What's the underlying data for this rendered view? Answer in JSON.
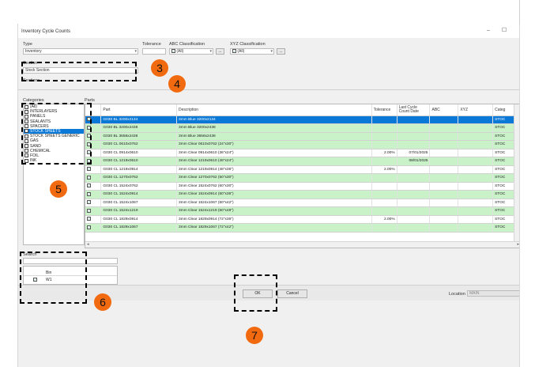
{
  "window": {
    "title": "Inventory Cycle Counts",
    "minimize": "–",
    "maximize": "☐"
  },
  "filters": {
    "type_label": "Type",
    "type_value": "Inventory",
    "tolerance_label": "Tolerance",
    "tolerance_value": "",
    "abc_label": "ABC Classification",
    "abc_value": "(All)",
    "xyz_label": "XYZ Classification",
    "xyz_value": "(All)",
    "ellipsis": "...",
    "section_label": "Section",
    "section_value": "Stock Section",
    "sections_label": "Sections"
  },
  "categories": {
    "label": "Categories",
    "items": [
      {
        "label": "(All)",
        "selected": false
      },
      {
        "label": "INTERLAYERS",
        "selected": false
      },
      {
        "label": "PANELS",
        "selected": false
      },
      {
        "label": "SEALANTS",
        "selected": false
      },
      {
        "label": "SPACERS",
        "selected": false
      },
      {
        "label": "STOCK SHEETS",
        "selected": true
      },
      {
        "label": "STOCK SHEETS GENERIC",
        "selected": false
      },
      {
        "label": "GAS",
        "selected": false
      },
      {
        "label": "SAND",
        "selected": false
      },
      {
        "label": "CHEMICAL",
        "selected": false
      },
      {
        "label": "FOIL",
        "selected": false
      },
      {
        "label": "INK",
        "selected": false
      }
    ]
  },
  "parts": {
    "label": "Parts",
    "columns": [
      "Part",
      "Description",
      "Tolerance",
      "Last Cycle Count Date",
      "ABC",
      "XYZ",
      "Categ"
    ],
    "rows": [
      {
        "part": "G030 BL 3200x2134",
        "desc": "3mm Blue 3200x2134",
        "tol": "",
        "date": "",
        "abc": "",
        "xyz": "",
        "cat": "STOC",
        "checked": true,
        "style": "selrow"
      },
      {
        "part": "G030 BL 3200x2438",
        "desc": "3mm Blue 3200x2438",
        "tol": "",
        "date": "",
        "abc": "",
        "xyz": "",
        "cat": "STOC",
        "checked": true,
        "style": "green"
      },
      {
        "part": "G030 BL 3658x2438",
        "desc": "3mm Blue 3658x2438",
        "tol": "",
        "date": "",
        "abc": "",
        "xyz": "",
        "cat": "STOC",
        "checked": true,
        "style": "green"
      },
      {
        "part": "G030 CL 0610x0762",
        "desc": "3mm Clear 0610x0762 (24\"x30\")",
        "tol": "",
        "date": "",
        "abc": "",
        "xyz": "",
        "cat": "STOC",
        "checked": true,
        "style": "green"
      },
      {
        "part": "G030 CL 0914x0610",
        "desc": "3mm Clear 0914x0610 (36\"x24\")",
        "tol": "2.00%",
        "date": "07/01/2025",
        "abc": "",
        "xyz": "",
        "cat": "STOC",
        "checked": true,
        "style": "white"
      },
      {
        "part": "G030 CL 1219x0610",
        "desc": "3mm Clear 1219x0610 (48\"x24\")",
        "tol": "",
        "date": "08/01/2025",
        "abc": "",
        "xyz": "",
        "cat": "STOC",
        "checked": true,
        "style": "green"
      },
      {
        "part": "G030 CL 1219x0914",
        "desc": "3mm Clear 1219x0914 (48\"x36\")",
        "tol": "2.00%",
        "date": "",
        "abc": "",
        "xyz": "",
        "cat": "STOC",
        "checked": true,
        "style": "white"
      },
      {
        "part": "G030 CL 1270x0762",
        "desc": "3mm Clear 1270x0762 (50\"x30\")",
        "tol": "",
        "date": "",
        "abc": "",
        "xyz": "",
        "cat": "STOC",
        "checked": true,
        "style": "green"
      },
      {
        "part": "G030 CL 1524x0762",
        "desc": "3mm Clear 1524x0762 (60\"x30\")",
        "tol": "",
        "date": "",
        "abc": "",
        "xyz": "",
        "cat": "STOC",
        "checked": true,
        "style": "white"
      },
      {
        "part": "G030 CL 1524x0914",
        "desc": "3mm Clear 1524x0914 (60\"x36\")",
        "tol": "",
        "date": "",
        "abc": "",
        "xyz": "",
        "cat": "STOC",
        "checked": true,
        "style": "green"
      },
      {
        "part": "G030 CL 1524x1067",
        "desc": "3mm Clear 1524x1067 (60\"x42\")",
        "tol": "",
        "date": "",
        "abc": "",
        "xyz": "",
        "cat": "STOC",
        "checked": true,
        "style": "white"
      },
      {
        "part": "G030 CL 1524x1219",
        "desc": "3mm Clear 1524x1219 (60\"x48\")",
        "tol": "",
        "date": "",
        "abc": "",
        "xyz": "",
        "cat": "STOC",
        "checked": true,
        "style": "green"
      },
      {
        "part": "G030 CL 1829x0914",
        "desc": "3mm Clear 1829x0914 (72\"x36\")",
        "tol": "2.00%",
        "date": "",
        "abc": "",
        "xyz": "",
        "cat": "STOC",
        "checked": true,
        "style": "white"
      },
      {
        "part": "G030 CL 1829x1067",
        "desc": "3mm Clear 1829x1067 (72\"x42\")",
        "tol": "",
        "date": "",
        "abc": "",
        "xyz": "",
        "cat": "STOC",
        "checked": true,
        "style": "green"
      }
    ]
  },
  "bins": {
    "search_label": "Search",
    "search_value": "",
    "header": "Bin",
    "rows": [
      {
        "label": "W1",
        "checked": true
      }
    ]
  },
  "buttons": {
    "ok": "OK",
    "cancel": "Cancel"
  },
  "location": {
    "label": "Location",
    "value": "MAIN"
  },
  "markers": [
    "3",
    "4",
    "5",
    "6",
    "7"
  ],
  "colors": {
    "accent": "#0a78d7",
    "row_green": "#c9f2c9",
    "marker": "#f26a10"
  }
}
